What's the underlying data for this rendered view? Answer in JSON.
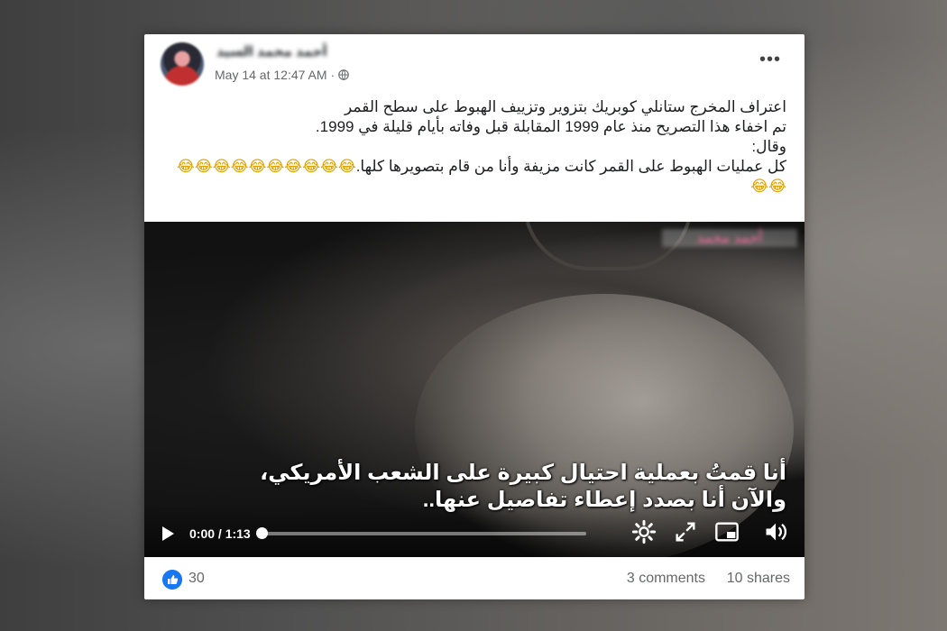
{
  "post": {
    "author_name": "أحمد محمد السيد",
    "timestamp": "May 14 at 12:47 AM",
    "privacy_icon": "globe-icon",
    "more_icon": "more-options-icon",
    "more_label": "•••",
    "text_lines": [
      "اعتراف المخرج ستانلي كوبريك بتزوير وتزييف الهبوط على سطح القمر",
      "تم اخفاء هذا التصريح منذ عام 1999 المقابلة قبل وفاته بأيام قليلة في 1999.",
      "وقال:",
      "كل عمليات الهبوط على القمر كانت مزيفة وأنا من قام بتصويرها كلها."
    ],
    "emoji_run_1": "😂😂😂😂😂😂😂😂😂😂",
    "emoji_run_2": "😂😂"
  },
  "video": {
    "watermark": "أحمد محمد",
    "subtitle_line_1": "أنا قمتُ بعملية احتيال كبيرة على الشعب الأمريكي،",
    "subtitle_line_2": "والآن أنا بصدد إعطاء تفاصيل عنها..",
    "time_display": "0:00 / 1:13",
    "progress": 0.0,
    "icons": [
      "play-icon",
      "settings-icon",
      "fullscreen-icon",
      "picture-in-picture-icon",
      "volume-icon"
    ]
  },
  "footer": {
    "likes_count": "30",
    "comments_label": "3 comments",
    "shares_label": "10 shares"
  },
  "colors": {
    "facebook_blue": "#1877f2",
    "secondary_text": "#65676b",
    "primary_text": "#1c1e21"
  }
}
